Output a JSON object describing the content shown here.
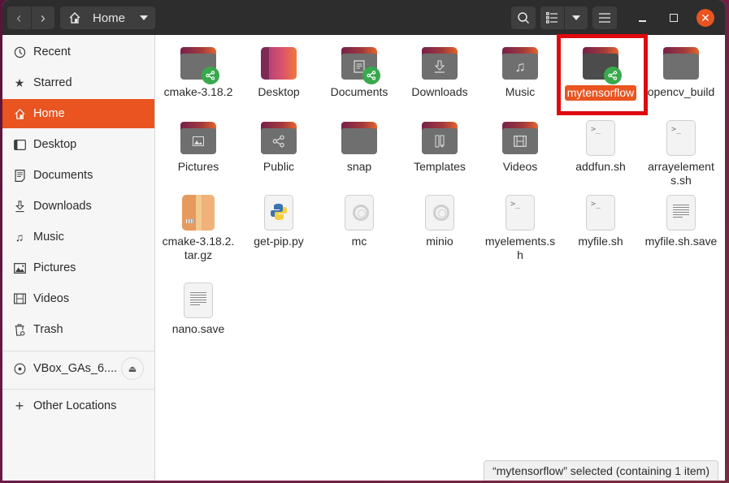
{
  "header": {
    "path_label": "Home",
    "back_icon": "chevron-left-icon",
    "forward_icon": "chevron-right-icon",
    "home_icon": "home-icon"
  },
  "sidebar": {
    "items": [
      {
        "label": "Recent",
        "icon": "clock-icon"
      },
      {
        "label": "Starred",
        "icon": "star-icon"
      },
      {
        "label": "Home",
        "icon": "home-icon",
        "active": true
      },
      {
        "label": "Desktop",
        "icon": "desktop-icon"
      },
      {
        "label": "Documents",
        "icon": "documents-icon"
      },
      {
        "label": "Downloads",
        "icon": "download-icon"
      },
      {
        "label": "Music",
        "icon": "music-icon"
      },
      {
        "label": "Pictures",
        "icon": "pictures-icon"
      },
      {
        "label": "Videos",
        "icon": "videos-icon"
      },
      {
        "label": "Trash",
        "icon": "trash-icon"
      }
    ],
    "device": {
      "label": "VBox_GAs_6....",
      "icon": "disc-icon",
      "eject_icon": "eject-icon"
    },
    "other_locations": {
      "label": "Other Locations",
      "icon": "plus-icon"
    }
  },
  "files": [
    {
      "name": "cmake-3.18.2",
      "type": "folder-shared"
    },
    {
      "name": "Desktop",
      "type": "desktop"
    },
    {
      "name": "Documents",
      "type": "folder-documents-shared"
    },
    {
      "name": "Downloads",
      "type": "folder-downloads"
    },
    {
      "name": "Music",
      "type": "folder-music"
    },
    {
      "name": "mytensorflow",
      "type": "folder-shared",
      "selected": true
    },
    {
      "name": "opencv_build",
      "type": "folder"
    },
    {
      "name": "Pictures",
      "type": "folder-pictures"
    },
    {
      "name": "Public",
      "type": "folder-public"
    },
    {
      "name": "snap",
      "type": "folder"
    },
    {
      "name": "Templates",
      "type": "folder-templates"
    },
    {
      "name": "Videos",
      "type": "folder-videos"
    },
    {
      "name": "addfun.sh",
      "type": "script"
    },
    {
      "name": "arrayelements.sh",
      "type": "script"
    },
    {
      "name": "cmake-3.18.2.tar.gz",
      "type": "archive"
    },
    {
      "name": "get-pip.py",
      "type": "python"
    },
    {
      "name": "mc",
      "type": "executable"
    },
    {
      "name": "minio",
      "type": "executable"
    },
    {
      "name": "myelements.sh",
      "type": "script"
    },
    {
      "name": "myfile.sh",
      "type": "script"
    },
    {
      "name": "myfile.sh.save",
      "type": "text"
    },
    {
      "name": "nano.save",
      "type": "text"
    }
  ],
  "status": {
    "text": "“mytensorflow” selected  (containing 1 item)"
  },
  "colors": {
    "accent": "#e95420",
    "highlight_box": "#e0090e",
    "share_badge": "#38a94d"
  }
}
